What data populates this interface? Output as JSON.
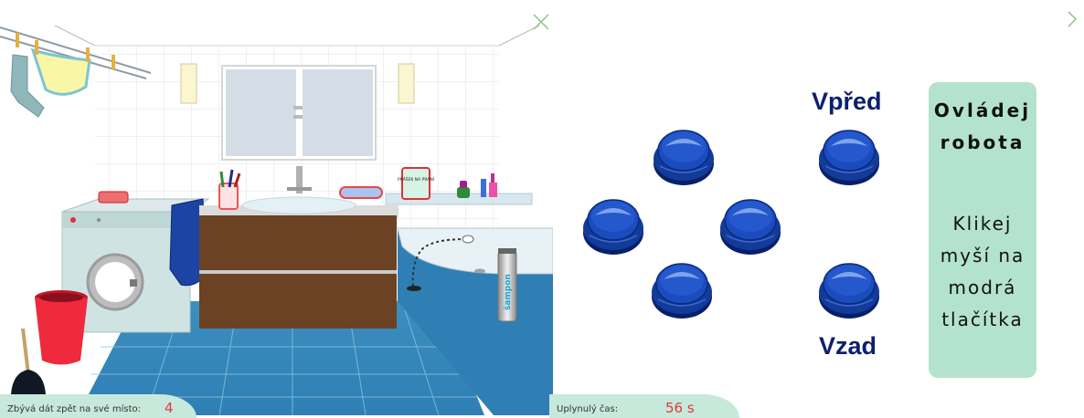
{
  "scene": {
    "soap_box_label": "PRÁŠEK NA PRANÍ",
    "shampoo_label": "šampon"
  },
  "status": {
    "remaining_label": "Zbývá dát zpět na své místo:",
    "remaining_value": "4",
    "elapsed_label": "Uplynulý čas:",
    "elapsed_value": "56 s"
  },
  "controls": {
    "forward_label": "Vpřed",
    "backward_label": "Vzad",
    "button_color": "#123b9a"
  },
  "panel": {
    "title": "Ovládej\nrobota",
    "instructions": "Klikej\nmyší na\nmodrá\ntlačítka"
  },
  "icons": {
    "close": "close-x-icon",
    "next": "chevron-right-icon"
  }
}
